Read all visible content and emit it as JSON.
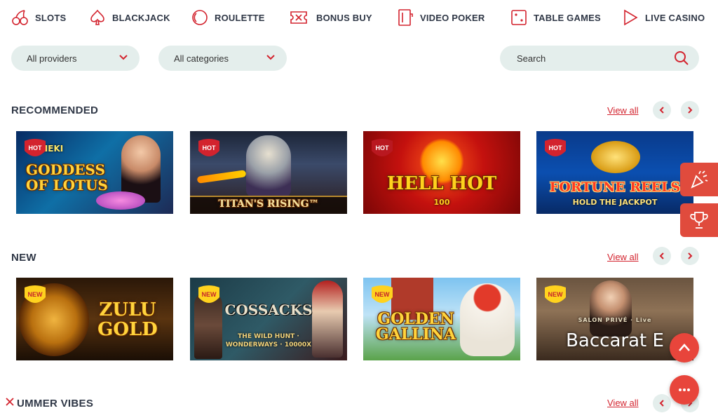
{
  "nav": [
    {
      "label": "SLOTS",
      "icon": "cherries-icon"
    },
    {
      "label": "BLACKJACK",
      "icon": "spade-icon"
    },
    {
      "label": "ROULETTE",
      "icon": "roulette-icon"
    },
    {
      "label": "BONUS BUY",
      "icon": "ticket-icon"
    },
    {
      "label": "VIDEO POKER",
      "icon": "video-poker-icon"
    },
    {
      "label": "TABLE GAMES",
      "icon": "dice-icon"
    },
    {
      "label": "LIVE CASINO",
      "icon": "play-icon"
    }
  ],
  "filters": {
    "providers": "All providers",
    "categories": "All categories",
    "search_placeholder": "Search"
  },
  "sections": [
    {
      "title": "RECOMMENDED",
      "view_all": "View all",
      "games": [
        {
          "title": "GODDESS OF LOTUS",
          "subtitle": "MANEKI",
          "badge": "HOT"
        },
        {
          "title": "TITAN'S RISING™",
          "subtitle": "",
          "badge": "HOT"
        },
        {
          "title": "HELL HOT",
          "subtitle": "100",
          "badge": "HOT"
        },
        {
          "title": "FORTUNE REELS",
          "subtitle": "HOLD THE JACKPOT",
          "badge": "HOT"
        }
      ]
    },
    {
      "title": "NEW",
      "view_all": "View all",
      "games": [
        {
          "title": "ZULU GOLD",
          "subtitle": "",
          "badge": "NEW"
        },
        {
          "title": "COSSACKS",
          "subtitle": "THE WILD HUNT · WONDERWAYS · 10000X",
          "badge": "NEW"
        },
        {
          "title": "GOLDEN GALLINA",
          "subtitle": "",
          "badge": "NEW"
        },
        {
          "title": "Baccarat E",
          "subtitle": "SALON PRIVÉ · Live",
          "badge": "NEW"
        }
      ]
    },
    {
      "title": "UMMER VIBES",
      "view_all": "View all",
      "games": []
    }
  ],
  "colors": {
    "accent": "#d3232e",
    "pill_bg": "#e4eeec",
    "text": "#2f3746",
    "fab": "#e8453b"
  }
}
